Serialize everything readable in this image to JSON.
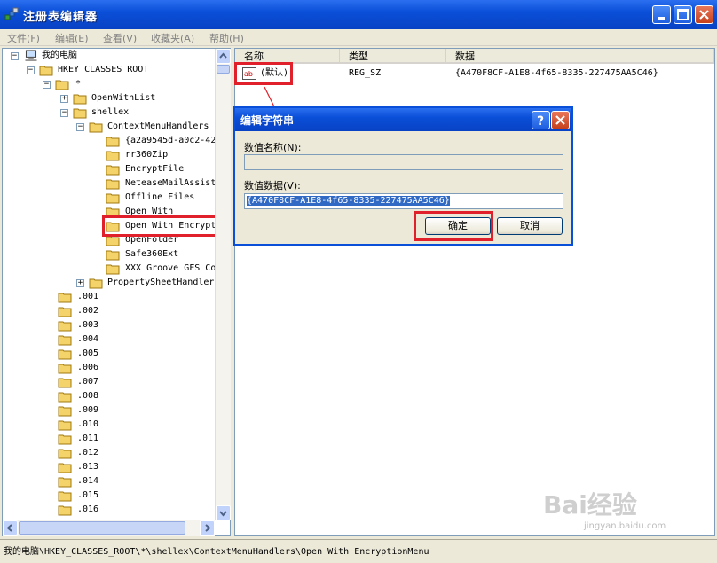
{
  "window": {
    "title": "注册表编辑器"
  },
  "menu": [
    "文件(F)",
    "编辑(E)",
    "查看(V)",
    "收藏夹(A)",
    "帮助(H)"
  ],
  "tree": {
    "root": "我的电脑",
    "hkcr": "HKEY_CLASSES_ROOT",
    "star": "*",
    "openwithlist": "OpenWithList",
    "shellex": "shellex",
    "cmh": "ContextMenuHandlers",
    "handlers": [
      "{a2a9545d-a0c2-42",
      "rr360Zip",
      "EncryptFile",
      "NeteaseMailAssist",
      "Offline Files",
      "Open With",
      "Open With Encrypt",
      "OpenFolder",
      "Safe360Ext",
      "XXX Groove GFS Co"
    ],
    "psh": "PropertySheetHandler",
    "extensions": [
      ".001",
      ".002",
      ".003",
      ".004",
      ".005",
      ".006",
      ".007",
      ".008",
      ".009",
      ".010",
      ".011",
      ".012",
      ".013",
      ".014",
      ".015",
      ".016"
    ]
  },
  "list": {
    "columns": [
      "名称",
      "类型",
      "数据"
    ],
    "row": {
      "name": "(默认)",
      "type": "REG_SZ",
      "data": "{A470F8CF-A1E8-4f65-8335-227475AA5C46}",
      "icon": "string-value-icon"
    }
  },
  "dialog": {
    "title": "编辑字符串",
    "name_label": "数值名称(N):",
    "name_value": "",
    "data_label": "数值数据(V):",
    "data_value": "{A470F8CF-A1E8-4f65-8335-227475AA5C46}",
    "ok": "确定",
    "cancel": "取消"
  },
  "status": "我的电脑\\HKEY_CLASSES_ROOT\\*\\shellex\\ContextMenuHandlers\\Open With EncryptionMenu",
  "watermark": {
    "big": "Bai经验",
    "small": "jingyan.baidu.com"
  },
  "colors": {
    "accent": "#0a4fd8",
    "highlight": "#e0202a",
    "selection": "#316ac5"
  }
}
